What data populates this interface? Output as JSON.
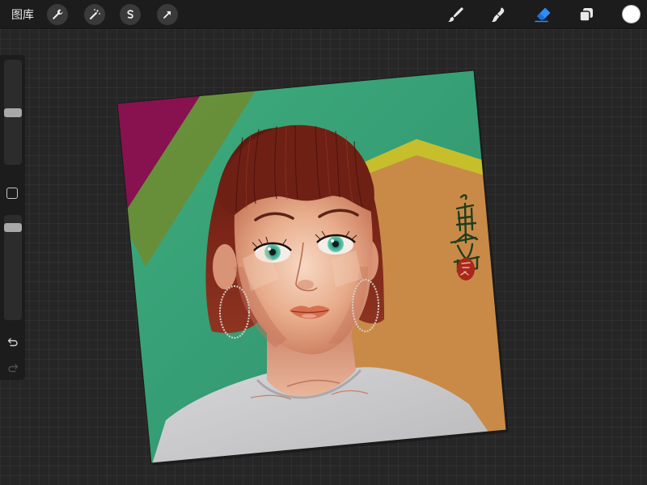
{
  "topbar": {
    "gallery_label": "图库",
    "left_tools": [
      {
        "id": "actions",
        "icon": "wrench-icon"
      },
      {
        "id": "adjustments",
        "icon": "magic-wand-icon"
      },
      {
        "id": "selection",
        "icon": "selection-s-icon"
      },
      {
        "id": "transform",
        "icon": "arrow-cursor-icon"
      }
    ],
    "right_tools": [
      {
        "id": "brush",
        "icon": "brush-icon",
        "active": false
      },
      {
        "id": "smudge",
        "icon": "smudge-icon",
        "active": false
      },
      {
        "id": "eraser",
        "icon": "eraser-icon",
        "active": true
      },
      {
        "id": "layers",
        "icon": "layers-icon",
        "active": false
      }
    ],
    "current_color": "#ffffff"
  },
  "sidebar": {
    "brush_size_level": 0.5,
    "opacity_level": 0.08,
    "undo_icon": "undo-arrow-icon",
    "redo_icon": "redo-arrow-icon"
  },
  "canvas": {
    "signature": "果酱",
    "seal": "果酱"
  },
  "colors": {
    "accent": "#2d8cff",
    "ui_background": "#1c1c1c",
    "workspace": "#262626",
    "bg_green": "#3fa67a",
    "bg_magenta": "#8a1556",
    "bg_olive": "#6f8f34",
    "bg_yellow": "#c9c12a",
    "bg_orange": "#c98a48",
    "hair": "#6b1e14",
    "shirt": "#c9c9cb",
    "eye": "#52c9a8",
    "seal_red": "#b02a1e"
  }
}
